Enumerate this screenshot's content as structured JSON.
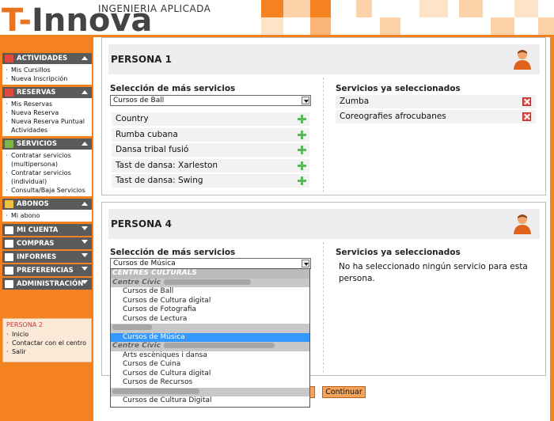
{
  "header": {
    "tagline": "INGENIERIA APLICADA",
    "logo_t": "T-",
    "logo_rest": "Innova",
    "accent": "#f58220"
  },
  "sidebar": {
    "sections": [
      {
        "title": "ACTIVIDADES",
        "icon": "calendar-icon",
        "expanded": true,
        "items": [
          "Mis Cursillos",
          "Nueva Inscripción"
        ]
      },
      {
        "title": "RESERVAS",
        "icon": "calendar-icon",
        "expanded": true,
        "items": [
          "Mis Reservas",
          "Nueva Reserva",
          "Nueva Reserva Puntual Actividades"
        ]
      },
      {
        "title": "SERVICIOS",
        "icon": "list-icon",
        "expanded": true,
        "items": [
          "Contratar servicios (multipersona)",
          "Contratar servicios (individual)",
          "Consulta/Baja Servicios"
        ]
      },
      {
        "title": "ABONOS",
        "icon": "card-icon",
        "expanded": true,
        "items": [
          "Mi abono"
        ]
      },
      {
        "title": "MI CUENTA",
        "icon": "user-icon",
        "expanded": false,
        "items": []
      },
      {
        "title": "COMPRAS",
        "icon": "cart-icon",
        "expanded": false,
        "items": []
      },
      {
        "title": "INFORMES",
        "icon": "chart-icon",
        "expanded": false,
        "items": []
      },
      {
        "title": "PREFERENCIAS",
        "icon": "gear-icon",
        "expanded": false,
        "items": []
      },
      {
        "title": "ADMINISTRACIÓN",
        "icon": "admin-icon",
        "expanded": false,
        "items": []
      }
    ],
    "user_box": {
      "user": "PERSONA 2",
      "links": [
        "Inicio",
        "Contactar con el centro",
        "Salir"
      ]
    }
  },
  "panel1": {
    "title": "PERSONA 1",
    "more_label": "Selección de más servicios",
    "select_value": "Cursos de Ball",
    "available": [
      "Country",
      "Rumba cubana",
      "Dansa tribal fusió",
      "Tast de dansa: Xarleston",
      "Tast de dansa: Swing"
    ],
    "selected_label": "Servicios ya seleccionados",
    "selected": [
      "Zumba",
      "Coreografies afrocubanes"
    ]
  },
  "panel2": {
    "title": "PERSONA 4",
    "more_label": "Selección de más servicios",
    "select_value": "Cursos de Música",
    "selected_label": "Servicios ya seleccionados",
    "empty_msg": "No ha seleccionado ningún servicio para esta persona."
  },
  "dropdown": {
    "groups": [
      {
        "label": "CENTRES CULTURALS",
        "kind": "group",
        "options": []
      },
      {
        "label": "Centre Cívic",
        "kind": "sub",
        "options": [
          "Cursos de Ball",
          "Cursos de Cultura digital",
          "Cursos de Fotografia",
          "Cursos de Lectura"
        ]
      },
      {
        "label": "",
        "kind": "sub",
        "options": [
          "Cursos de Música"
        ]
      },
      {
        "label": "Centre Cívic",
        "kind": "sub",
        "options": [
          "Arts escèniques i dansa",
          "Cursos de Cuina",
          "Cursos de Cultura digital",
          "Cursos de Recursos"
        ]
      },
      {
        "label": "",
        "kind": "sub",
        "options": [
          "Cursos de Cultura Digital"
        ]
      }
    ],
    "selected_option": "Cursos de Música"
  },
  "buttons": {
    "continue_label": "Continuar"
  }
}
